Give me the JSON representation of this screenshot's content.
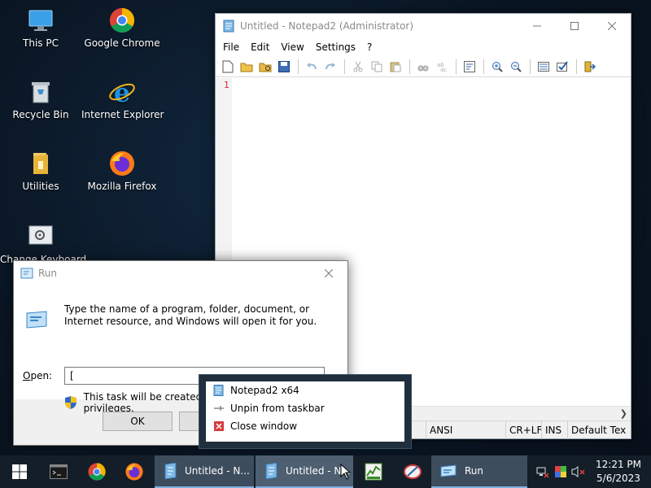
{
  "desktop": {
    "icons": [
      {
        "label": "This PC",
        "icon": "monitor-icon"
      },
      {
        "label": "Google Chrome",
        "icon": "chrome-icon"
      },
      {
        "label": "Recycle Bin",
        "icon": "recycle-bin-icon"
      },
      {
        "label": "Internet Explorer",
        "icon": "ie-icon"
      },
      {
        "label": "Utilities",
        "icon": "folder-icon"
      },
      {
        "label": "Mozilla Firefox",
        "icon": "firefox-icon"
      },
      {
        "label": "Change Keyboard",
        "icon": "keyboard-settings-icon"
      }
    ]
  },
  "notepad": {
    "title": "Untitled - Notepad2 (Administrator)",
    "menu": [
      "File",
      "Edit",
      "View",
      "Settings",
      "?"
    ],
    "line_number": "1",
    "status": {
      "encoding": "ANSI",
      "line_ending": "CR+LF",
      "mode": "INS",
      "scheme": "Default Tex"
    }
  },
  "run_dialog": {
    "title": "Run",
    "message": "Type the name of a program, folder, document, or Internet resource, and Windows will open it for you.",
    "open_label_underlined": "O",
    "open_label_rest": "pen:",
    "input_value": "[",
    "admin_note": "This task will be created with administrative privileges.",
    "ok_label": "OK"
  },
  "jumplist": {
    "items": [
      {
        "label": "Notepad2 x64",
        "icon": "notepad-icon"
      },
      {
        "label": "Unpin from taskbar",
        "icon": "unpin-icon"
      },
      {
        "label": "Close window",
        "icon": "close-icon"
      }
    ]
  },
  "taskbar": {
    "windows": [
      {
        "label": "Untitled - N..."
      },
      {
        "label": "Untitled - N..."
      },
      {
        "label": "Run"
      }
    ],
    "clock": {
      "time": "12:21 PM",
      "date": "5/6/2023"
    }
  },
  "colors": {
    "taskbar_bg": "#131e29",
    "accent": "#7fb0e0",
    "line_number": "#dd2233",
    "close_red": "#d43d3d"
  }
}
